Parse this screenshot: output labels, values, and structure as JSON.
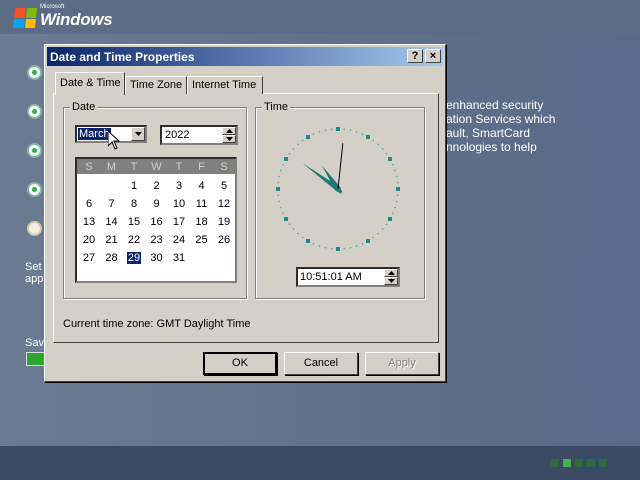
{
  "background": {
    "logo": {
      "small": "Microsoft",
      "big": "Windows"
    },
    "desc_lines": [
      "enhanced security",
      "ation Services which",
      "ault, SmartCard",
      "nnologies to help"
    ],
    "setup_lines": [
      "Set",
      "app"
    ],
    "save_text": "Sav"
  },
  "dialog": {
    "title": "Date and Time Properties",
    "help_label": "?",
    "close_label": "×",
    "tabs": [
      {
        "label": "Date & Time",
        "active": true
      },
      {
        "label": "Time Zone",
        "active": false
      },
      {
        "label": "Internet Time",
        "active": false
      }
    ],
    "date_group_label": "Date",
    "time_group_label": "Time",
    "month": "March",
    "year": "2022",
    "weekdays": [
      "S",
      "M",
      "T",
      "W",
      "T",
      "F",
      "S"
    ],
    "calendar_weeks": [
      [
        "",
        "",
        "1",
        "2",
        "3",
        "4",
        "5"
      ],
      [
        "6",
        "7",
        "8",
        "9",
        "10",
        "11",
        "12"
      ],
      [
        "13",
        "14",
        "15",
        "16",
        "17",
        "18",
        "19"
      ],
      [
        "20",
        "21",
        "22",
        "23",
        "24",
        "25",
        "26"
      ],
      [
        "27",
        "28",
        "29",
        "30",
        "31",
        "",
        ""
      ]
    ],
    "selected_day": "29",
    "time": "10:51:01 AM",
    "clock": {
      "hour": 10,
      "minute": 51,
      "second": 1
    },
    "timezone_label": "Current time zone:",
    "timezone_value": "GMT Daylight Time",
    "ok_label": "OK",
    "cancel_label": "Cancel",
    "apply_label": "Apply"
  },
  "colors": {
    "titlebar_start": "#0a246a",
    "titlebar_end": "#a6caf0",
    "selection": "#0a246a",
    "clock_hands": "#1e7a6e"
  }
}
